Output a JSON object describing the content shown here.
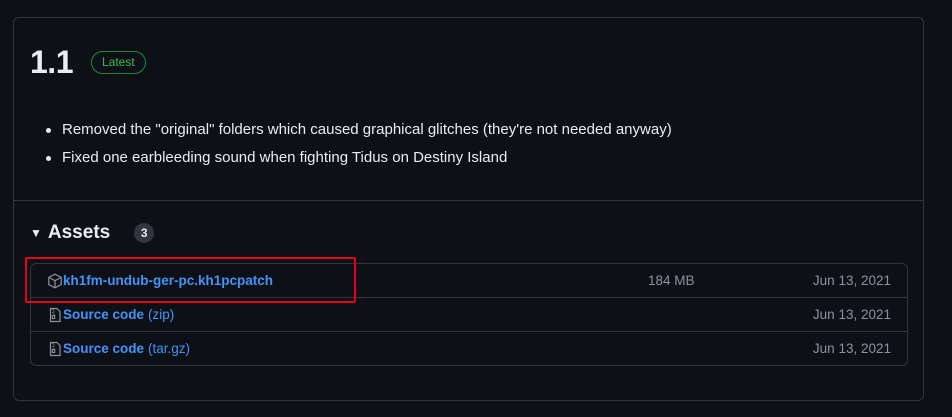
{
  "release": {
    "version": "1.1",
    "badge": "Latest",
    "notes": [
      "Removed the \"original\" folders which caused graphical glitches (they're not needed anyway)",
      "Fixed one earbleeding sound when fighting Tidus on Destiny Island"
    ]
  },
  "assets": {
    "title": "Assets",
    "count": "3",
    "items": [
      {
        "icon": "package-icon",
        "name": "kh1fm-undub-ger-pc.kh1pcpatch",
        "suffix": "",
        "size": "184 MB",
        "date": "Jun 13, 2021"
      },
      {
        "icon": "file-zip-icon",
        "name": "Source code",
        "suffix": "(zip)",
        "size": "",
        "date": "Jun 13, 2021"
      },
      {
        "icon": "file-zip-icon",
        "name": "Source code",
        "suffix": "(tar.gz)",
        "size": "",
        "date": "Jun 13, 2021"
      }
    ]
  },
  "colors": {
    "background": "#0d1117",
    "border": "#30363d",
    "link": "#4493f8",
    "badge_green": "#3fb950",
    "highlight": "#e5001b"
  }
}
